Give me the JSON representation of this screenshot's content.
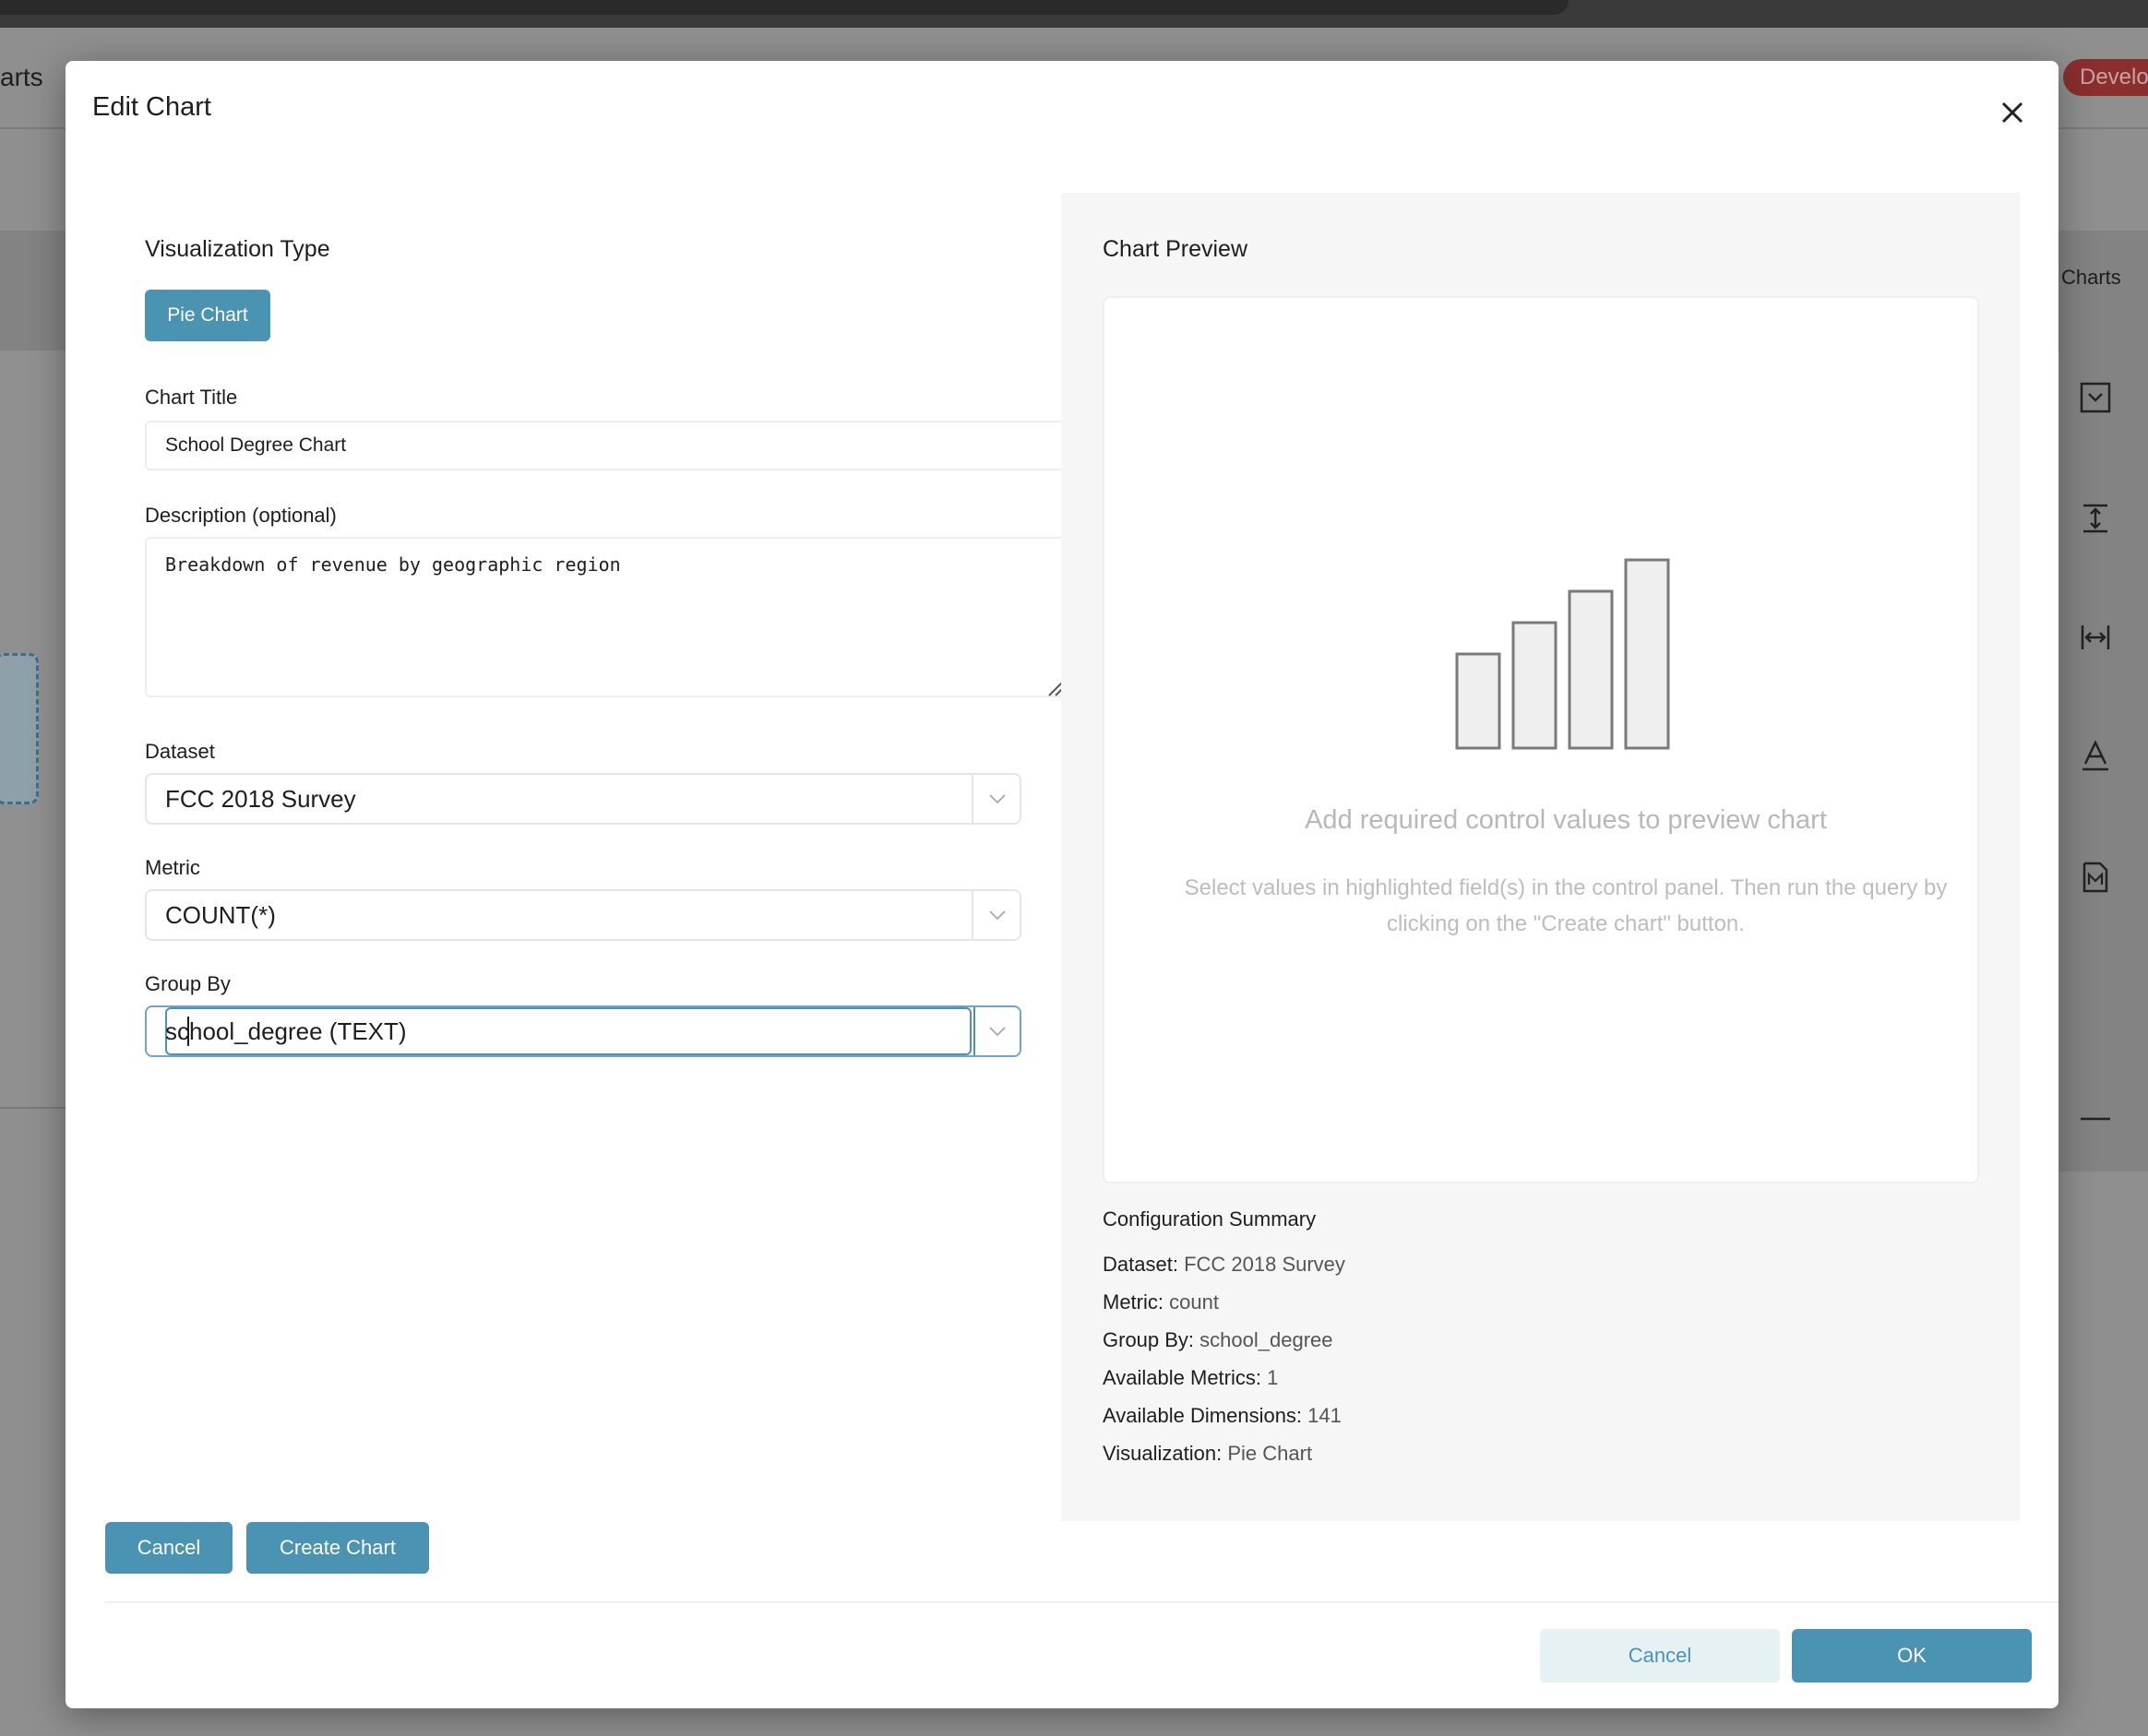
{
  "background": {
    "left_title": "arts",
    "badge": "Develop",
    "right_label": "Charts",
    "side_icons": [
      "dropdown-box-icon",
      "vertical-resize-icon",
      "horizontal-resize-icon",
      "text-format-icon",
      "markdown-icon",
      "divider-icon"
    ]
  },
  "modal": {
    "title": "Edit Chart",
    "visualization": {
      "heading": "Visualization Type",
      "selected": "Pie Chart"
    },
    "chart_title": {
      "label": "Chart Title",
      "value": "School Degree Chart"
    },
    "description": {
      "label": "Description (optional)",
      "value": "Breakdown of revenue by geographic region"
    },
    "dataset": {
      "label": "Dataset",
      "value": "FCC 2018 Survey"
    },
    "metric": {
      "label": "Metric",
      "value": "COUNT(*)"
    },
    "group_by": {
      "label": "Group By",
      "value": "school_degree (TEXT)"
    },
    "preview": {
      "heading": "Chart Preview",
      "empty_title": "Add required control values to preview chart",
      "empty_line1": "Select values in highlighted field(s) in the control panel. Then run the query by",
      "empty_line2": "clicking on the \"Create chart\" button."
    },
    "summary": {
      "heading": "Configuration Summary",
      "rows": [
        {
          "label": "Dataset:",
          "value": "FCC 2018 Survey"
        },
        {
          "label": "Metric:",
          "value": "count"
        },
        {
          "label": "Group By:",
          "value": "school_degree"
        },
        {
          "label": "Available Metrics:",
          "value": "1"
        },
        {
          "label": "Available Dimensions:",
          "value": "141"
        },
        {
          "label": "Visualization:",
          "value": "Pie Chart"
        }
      ]
    },
    "inner_buttons": {
      "cancel": "Cancel",
      "create": "Create Chart"
    },
    "footer": {
      "cancel": "Cancel",
      "ok": "OK"
    }
  },
  "colors": {
    "accent": "#4a93b3",
    "accent_light": "#e6f1f3",
    "badge": "#8a2e2e"
  }
}
